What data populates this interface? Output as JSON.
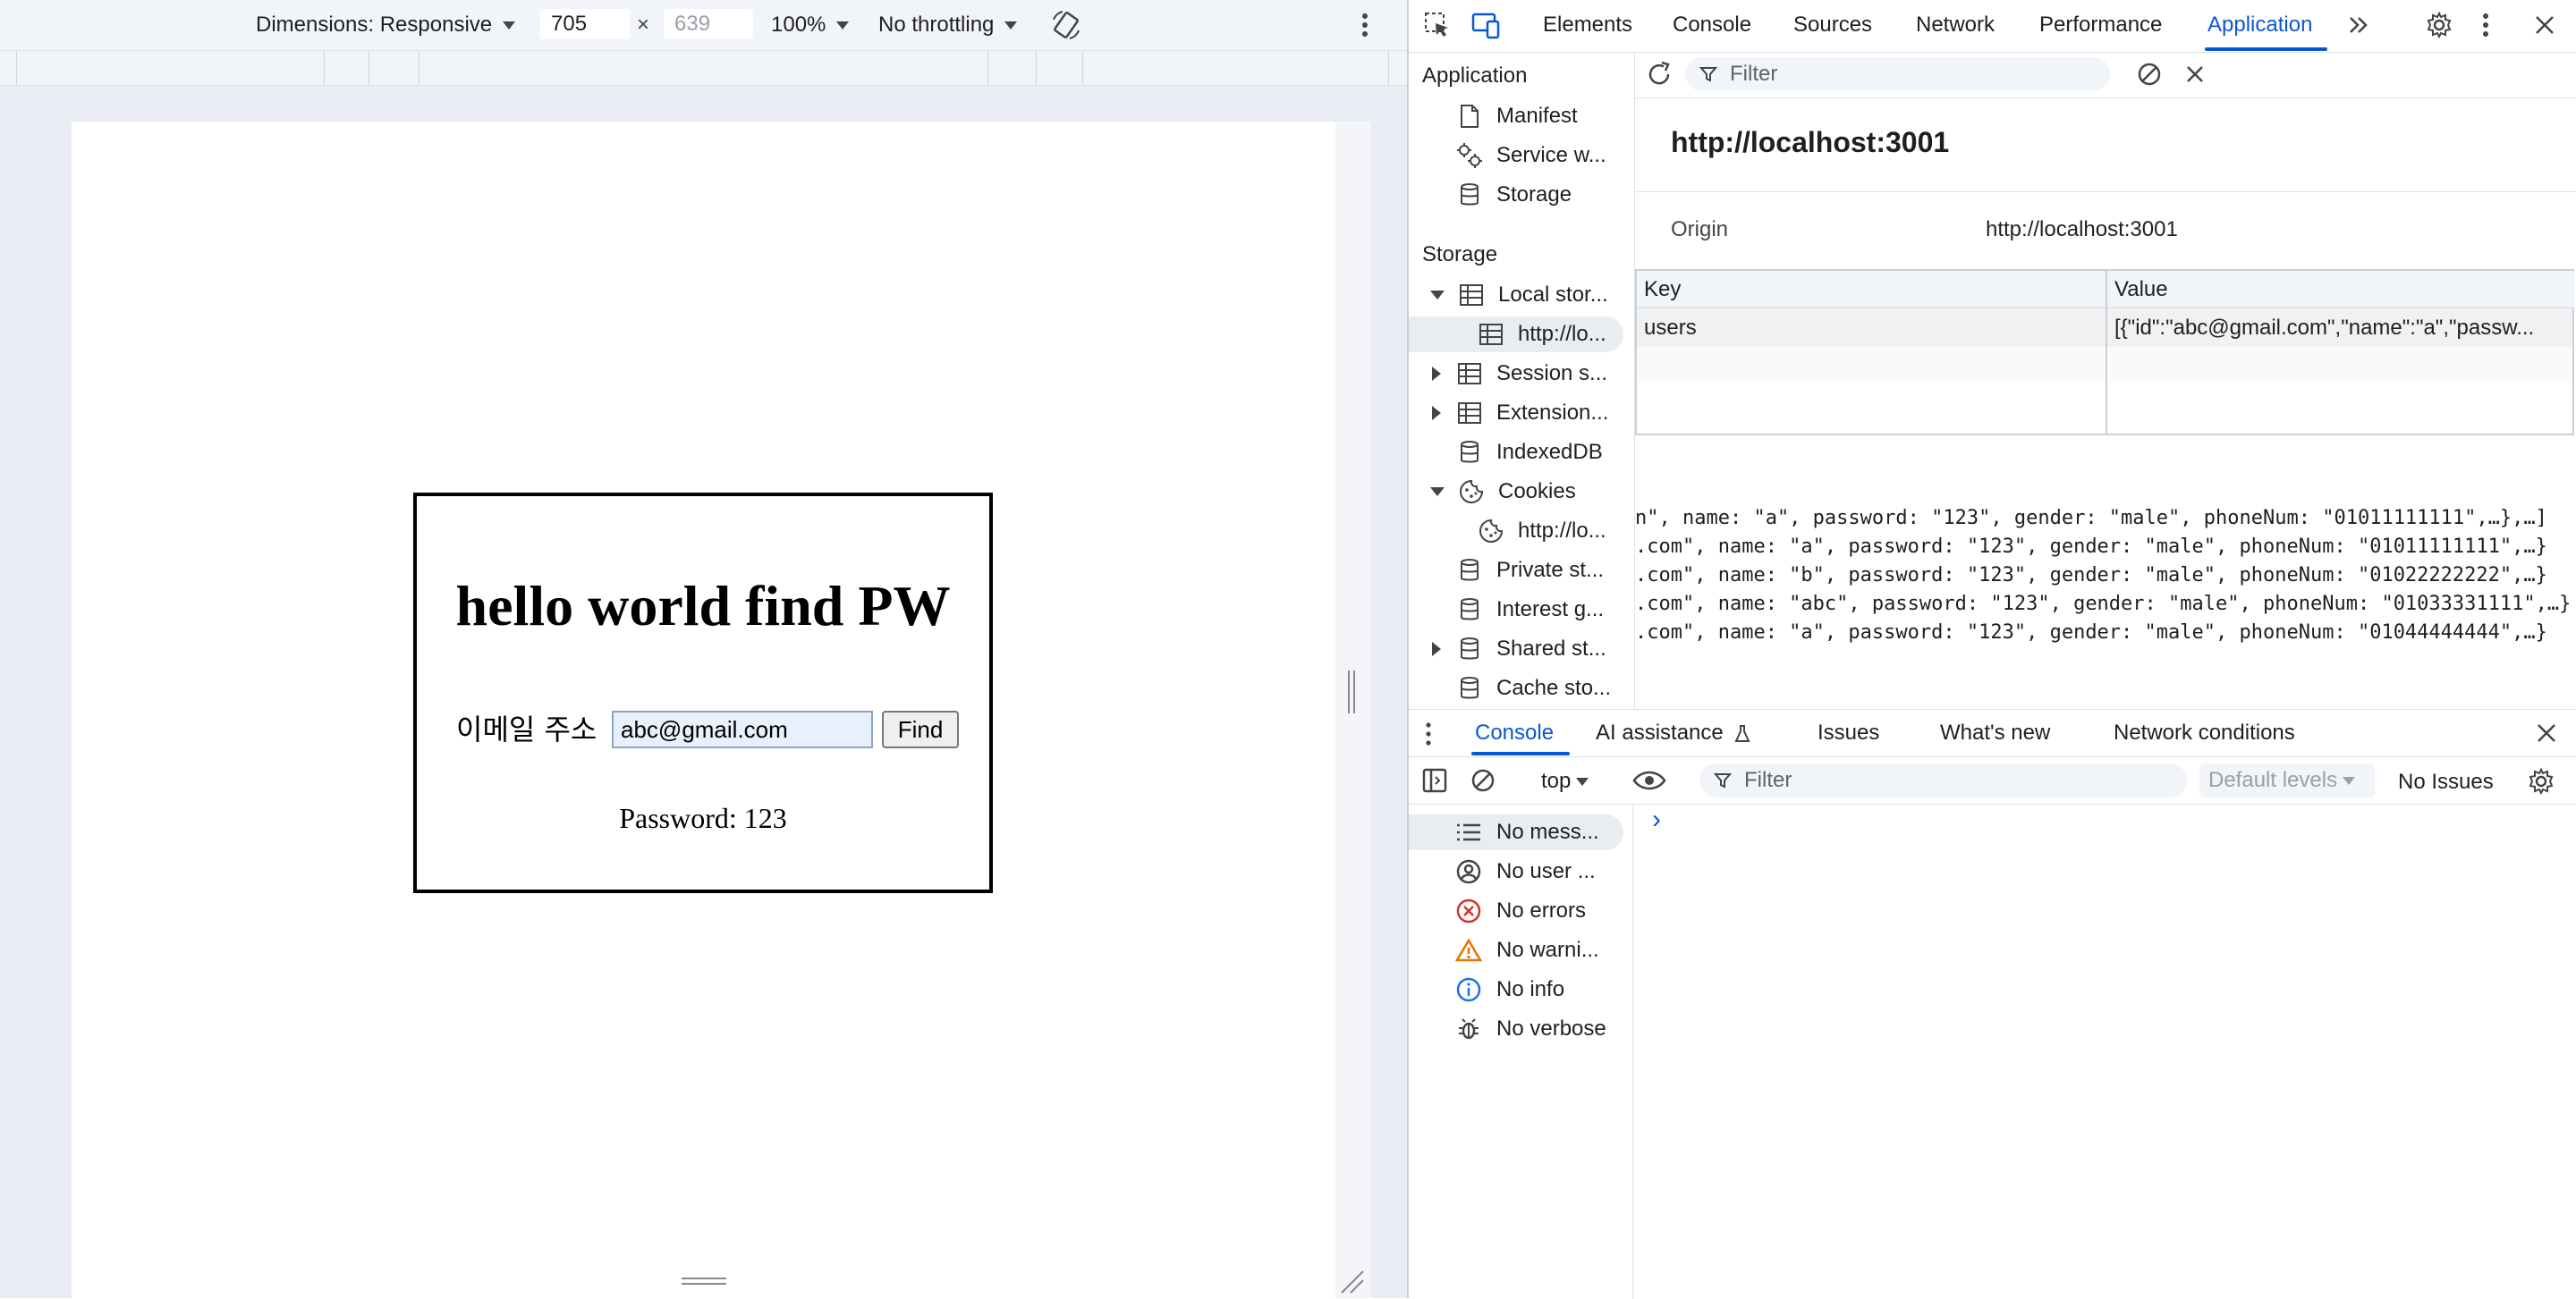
{
  "device_toolbar": {
    "dimensions_label": "Dimensions: Responsive",
    "width": "705",
    "x_sep": "×",
    "height": "639",
    "zoom": "100%",
    "throttling": "No throttling"
  },
  "page": {
    "title": "hello world find PW",
    "email_label": "이메일 주소",
    "email_value": "abc@gmail.com",
    "find_button": "Find",
    "password_result": "Password: 123"
  },
  "devtools_tabs": [
    "Elements",
    "Console",
    "Sources",
    "Network",
    "Performance",
    "Application"
  ],
  "active_tab": "Application",
  "app_sidebar": {
    "application_header": "Application",
    "application_items": [
      "Manifest",
      "Service w...",
      "Storage"
    ],
    "storage_header": "Storage",
    "storage_items": [
      "Local stor...",
      "http://lo...",
      "Session s...",
      "Extension...",
      "IndexedDB",
      "Cookies",
      "http://lo...",
      "Private st...",
      "Interest g...",
      "Shared st...",
      "Cache sto..."
    ]
  },
  "storage": {
    "filter_placeholder": "Filter",
    "origin_title": "http://localhost:3001",
    "origin_label": "Origin",
    "origin_value": "http://localhost:3001",
    "col_key": "Key",
    "col_value": "Value",
    "rows": [
      {
        "key": "users",
        "value": "[{\"id\":\"abc@gmail.com\",\"name\":\"a\",\"passw..."
      }
    ],
    "preview_lines": [
      "n\", name: \"a\", password: \"123\", gender: \"male\", phoneNum: \"01011111111\",…},…]",
      ".com\", name: \"a\", password: \"123\", gender: \"male\", phoneNum: \"01011111111\",…}",
      ".com\", name: \"b\", password: \"123\", gender: \"male\", phoneNum: \"01022222222\",…}",
      ".com\", name: \"abc\", password: \"123\", gender: \"male\", phoneNum: \"01033331111\",…}",
      ".com\", name: \"a\", password: \"123\", gender: \"male\", phoneNum: \"01044444444\",…}"
    ]
  },
  "drawer": {
    "tabs": [
      "Console",
      "AI assistance",
      "Issues",
      "What's new",
      "Network conditions"
    ],
    "context": "top",
    "filter_placeholder": "Filter",
    "levels": "Default levels",
    "issues": "No Issues",
    "sidebar": [
      "No mess...",
      "No user ...",
      "No errors",
      "No warni...",
      "No info",
      "No verbose"
    ],
    "prompt": "›"
  },
  "colors": {
    "accent": "#0b57d0",
    "error": "#d93025",
    "warning": "#e37400",
    "info": "#1a73e8"
  }
}
